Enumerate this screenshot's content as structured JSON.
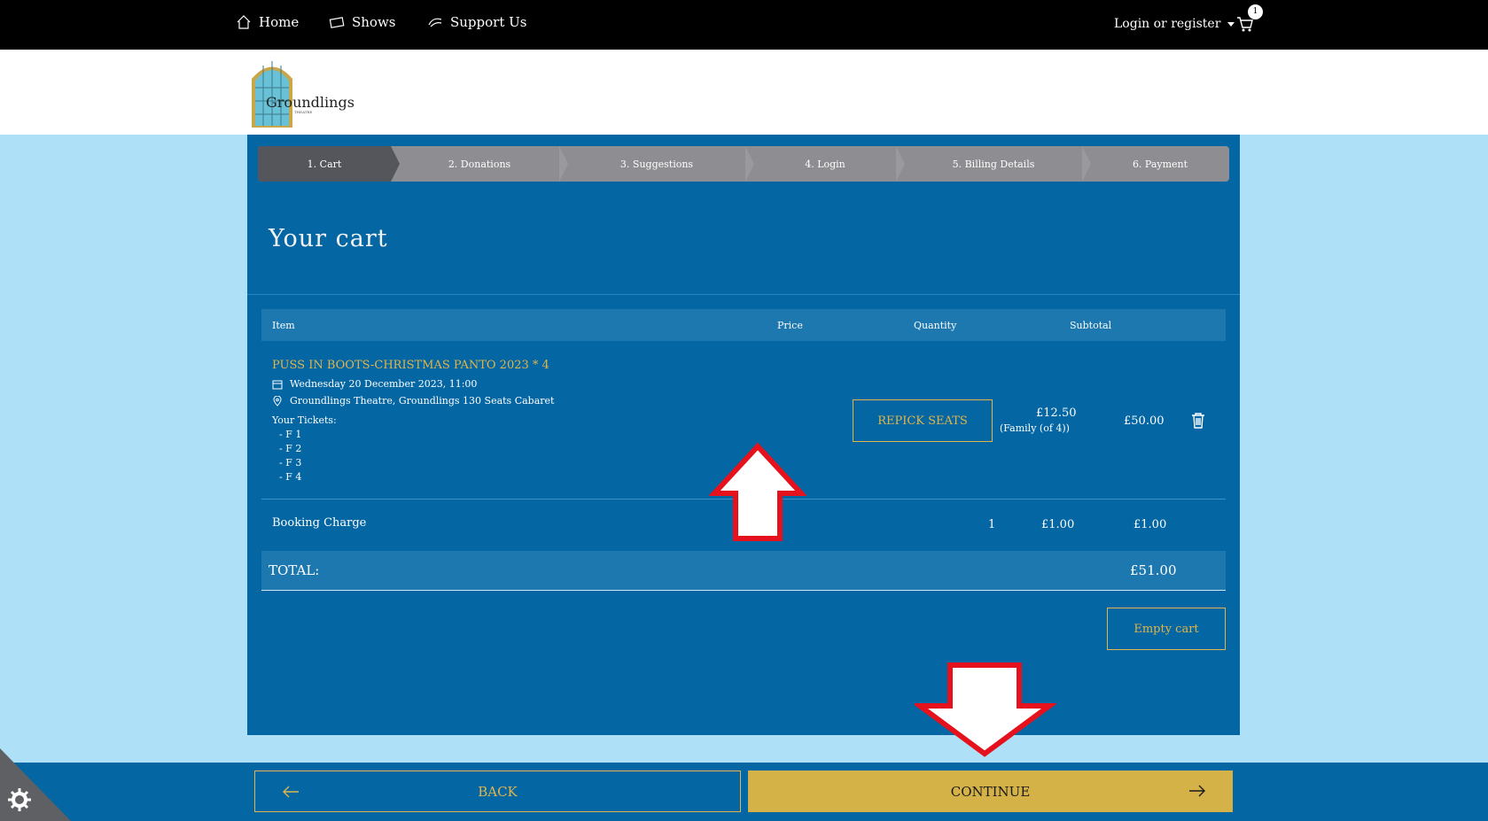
{
  "nav": {
    "home": "Home",
    "shows": "Shows",
    "support": "Support Us",
    "login": "Login or register",
    "cart_count": "1"
  },
  "brand": {
    "name": "Groundlings",
    "sub": "THEATRE"
  },
  "steps": [
    "1. Cart",
    "2. Donations",
    "3. Suggestions",
    "4. Login",
    "5. Billing Details",
    "6. Payment"
  ],
  "page_title": "Your cart",
  "table": {
    "headers": {
      "item": "Item",
      "price": "Price",
      "quantity": "Quantity",
      "subtotal": "Subtotal"
    },
    "item": {
      "title": "PUSS IN BOOTS-CHRISTMAS PANTO 2023 * 4",
      "date": "Wednesday 20 December 2023, 11:00",
      "venue": "Groundlings Theatre, Groundlings 130 Seats Cabaret",
      "tickets_label": "Your Tickets:",
      "tickets": [
        "- F 1",
        "- F 2",
        "- F 3",
        "- F 4"
      ],
      "price": "£12.50",
      "price_note": "(Family (of 4))",
      "repick_label": "REPICK SEATS",
      "subtotal": "£50.00"
    },
    "booking": {
      "label": "Booking Charge",
      "price": "£1.00",
      "quantity": "1",
      "subtotal": "£1.00"
    },
    "total_label": "TOTAL:",
    "total_value": "£51.00"
  },
  "empty_cart_label": "Empty cart",
  "footer": {
    "back_label": "BACK",
    "continue_label": "CONTINUE"
  },
  "colors": {
    "accent": "#d4b247",
    "panel": "#0466a3",
    "nav": "#000000",
    "annotation": "#e5121d"
  }
}
